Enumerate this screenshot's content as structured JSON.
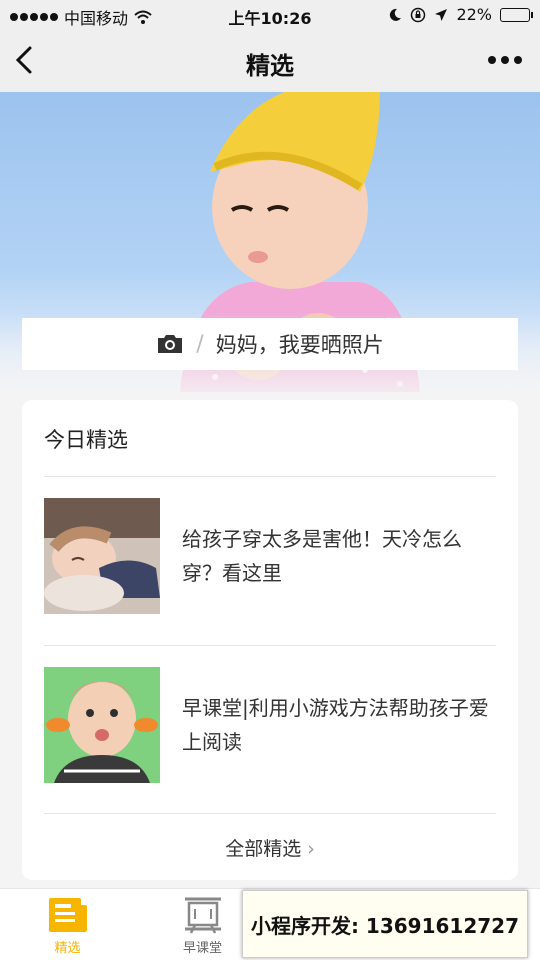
{
  "status_bar": {
    "carrier": "中国移动",
    "time": "上午10:26",
    "battery": "22%",
    "battery_level": 0.22
  },
  "nav": {
    "title": "精选"
  },
  "hero": {
    "upload_label": "妈妈，我要晒照片"
  },
  "featured": {
    "title": "今日精选",
    "articles": [
      {
        "title": "给孩子穿太多是害他！天冷怎么穿？看这里"
      },
      {
        "title": "早课堂|利用小游戏方法帮助孩子爱上阅读"
      }
    ],
    "all_label": "全部精选",
    "all_chevron": "›"
  },
  "tabs": [
    {
      "label": "精选",
      "icon": "newspaper-icon",
      "active": true
    },
    {
      "label": "早课堂",
      "icon": "blackboard-icon",
      "active": false
    }
  ],
  "promo": {
    "text": "小程序开发: 13691612727"
  },
  "colors": {
    "accent": "#f7b500",
    "hero_bg": "#a6c9f0"
  }
}
